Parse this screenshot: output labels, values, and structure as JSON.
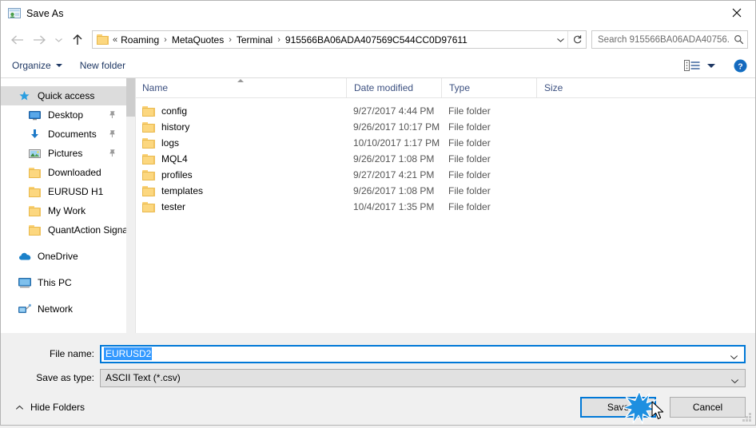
{
  "window": {
    "title": "Save As",
    "title_icon": "save-as-app-icon",
    "close_icon": "close-icon"
  },
  "navbar": {
    "back_icon": "back-arrow-icon",
    "forward_icon": "forward-arrow-icon",
    "recent_icon": "recent-locations-chevron-icon",
    "up_icon": "up-arrow-icon",
    "folder_icon": "folder-icon",
    "leading_chevrons": "«",
    "breadcrumbs": [
      "Roaming",
      "MetaQuotes",
      "Terminal",
      "915566BA06ADA407569C544CC0D97611"
    ],
    "separator": "›",
    "dropdown_icon": "chevron-down-icon",
    "refresh_icon": "refresh-icon"
  },
  "search": {
    "placeholder": "Search 915566BA06ADA40756...",
    "icon": "search-icon"
  },
  "toolbar": {
    "organize_label": "Organize",
    "organize_caret_icon": "chevron-down-icon",
    "new_folder_label": "New folder",
    "view_icon": "view-options-icon",
    "view_caret_icon": "chevron-down-icon",
    "help_icon": "help-icon",
    "help_label": "?"
  },
  "sidebar": {
    "items": [
      {
        "label": "Quick access",
        "icon": "star-icon",
        "level": "root",
        "selected": true,
        "pinned": false
      },
      {
        "label": "Desktop",
        "icon": "desktop-icon",
        "level": "child",
        "selected": false,
        "pinned": true
      },
      {
        "label": "Documents",
        "icon": "documents-download-icon",
        "level": "child",
        "selected": false,
        "pinned": true
      },
      {
        "label": "Pictures",
        "icon": "pictures-icon",
        "level": "child",
        "selected": false,
        "pinned": true
      },
      {
        "label": "Downloaded",
        "icon": "folder-icon",
        "level": "child",
        "selected": false,
        "pinned": false
      },
      {
        "label": "EURUSD H1",
        "icon": "folder-icon",
        "level": "child",
        "selected": false,
        "pinned": false
      },
      {
        "label": "My Work",
        "icon": "folder-icon",
        "level": "child",
        "selected": false,
        "pinned": false
      },
      {
        "label": "QuantAction Signal",
        "icon": "folder-icon",
        "level": "child",
        "selected": false,
        "pinned": false
      },
      {
        "label": "OneDrive",
        "icon": "onedrive-cloud-icon",
        "level": "group",
        "selected": false,
        "pinned": false
      },
      {
        "label": "This PC",
        "icon": "this-pc-icon",
        "level": "group",
        "selected": false,
        "pinned": false
      },
      {
        "label": "Network",
        "icon": "network-icon",
        "level": "group",
        "selected": false,
        "pinned": false
      }
    ]
  },
  "filelist": {
    "columns": [
      {
        "label": "Name",
        "sorted": true
      },
      {
        "label": "Date modified",
        "sorted": false
      },
      {
        "label": "Type",
        "sorted": false
      },
      {
        "label": "Size",
        "sorted": false
      }
    ],
    "rows": [
      {
        "name": "config",
        "date": "9/27/2017 4:44 PM",
        "type": "File folder",
        "size": ""
      },
      {
        "name": "history",
        "date": "9/26/2017 10:17 PM",
        "type": "File folder",
        "size": ""
      },
      {
        "name": "logs",
        "date": "10/10/2017 1:17 PM",
        "type": "File folder",
        "size": ""
      },
      {
        "name": "MQL4",
        "date": "9/26/2017 1:08 PM",
        "type": "File folder",
        "size": ""
      },
      {
        "name": "profiles",
        "date": "9/27/2017 4:21 PM",
        "type": "File folder",
        "size": ""
      },
      {
        "name": "templates",
        "date": "9/26/2017 1:08 PM",
        "type": "File folder",
        "size": ""
      },
      {
        "name": "tester",
        "date": "10/4/2017 1:35 PM",
        "type": "File folder",
        "size": ""
      }
    ]
  },
  "form": {
    "filename_label": "File name:",
    "filename_value": "EURUSD2",
    "savetype_label": "Save as type:",
    "savetype_value": "ASCII Text (*.csv)",
    "chevron_icon": "chevron-down-icon"
  },
  "footer": {
    "hide_folders_label": "Hide Folders",
    "hide_folders_icon": "chevron-up-icon",
    "save_label": "Save",
    "cancel_label": "Cancel",
    "resize_grip_icon": "resize-grip-icon",
    "click_burst_icon": "click-burst-icon",
    "cursor_icon": "mouse-cursor-icon"
  },
  "colors": {
    "accent": "#0078d7",
    "folder_yellow": "#fcd77f",
    "header_text": "#3c5080",
    "selection_blue": "#3399ff"
  }
}
